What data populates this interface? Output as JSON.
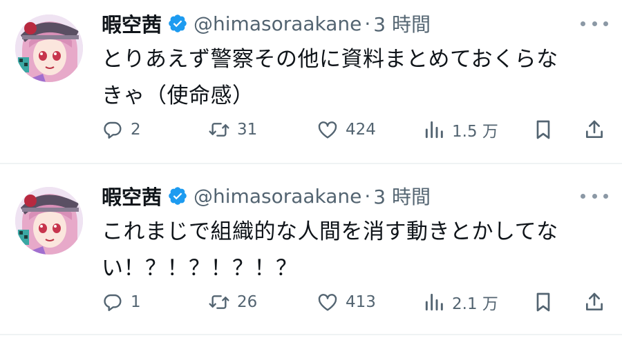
{
  "tweets": [
    {
      "display_name": "暇空茜",
      "handle": "@himasoraakane",
      "separator": "·",
      "time": "3 時間",
      "text_line1": "とりあえず警察その他に資料まとめておくらな",
      "text_line2": "きゃ（使命感）",
      "replies": "2",
      "retweets": "31",
      "likes": "424",
      "views": "1.5 万"
    },
    {
      "display_name": "暇空茜",
      "handle": "@himasoraakane",
      "separator": "·",
      "time": "3 時間",
      "text_line1": "これまじで組織的な人間を消す動きとかしてな",
      "text_line2": "い！？！？！？！？",
      "replies": "1",
      "retweets": "26",
      "likes": "413",
      "views": "2.1 万"
    }
  ],
  "icons": {
    "verified": "verified-badge-icon",
    "more": "more-horizontal-icon",
    "reply": "reply-icon",
    "retweet": "retweet-icon",
    "like": "heart-icon",
    "views": "analytics-icon",
    "bookmark": "bookmark-icon",
    "share": "share-icon"
  },
  "colors": {
    "verified": "#1d9bf0",
    "text": "#0f1419",
    "secondary": "#536471",
    "divider": "#eff3f4"
  }
}
